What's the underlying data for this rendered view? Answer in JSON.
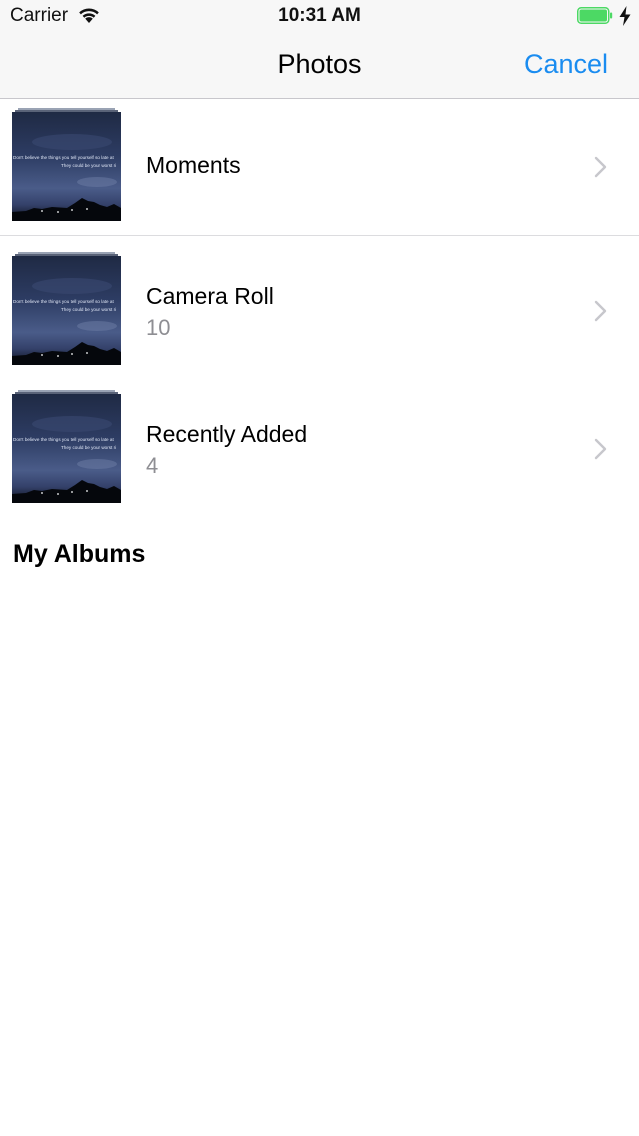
{
  "status_bar": {
    "carrier": "Carrier",
    "time": "10:31 AM",
    "battery_color": "#4cd964",
    "icons": [
      "wifi-icon",
      "battery-icon",
      "charging-bolt-icon"
    ]
  },
  "nav": {
    "title": "Photos",
    "cancel_label": "Cancel",
    "accent_color": "#1a8cf0"
  },
  "albums": [
    {
      "title": "Moments",
      "count": ""
    },
    {
      "title": "Camera Roll",
      "count": "10"
    },
    {
      "title": "Recently Added",
      "count": "4"
    }
  ],
  "thumbnail_text": {
    "line1": "Don't believe the things you tell yourself so late at",
    "line2": "They could be your worst ri"
  },
  "section": {
    "my_albums": "My Albums"
  }
}
